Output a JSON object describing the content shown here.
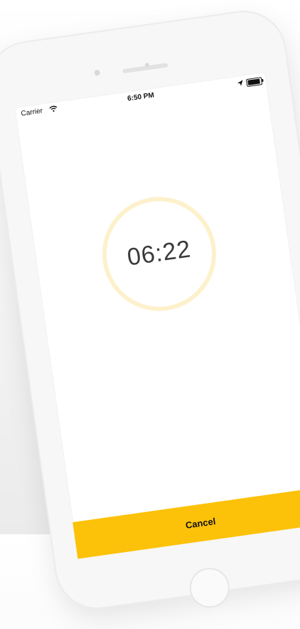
{
  "status_bar": {
    "carrier": "Carrier",
    "time": "6:50 PM",
    "icons": [
      "wifi-icon",
      "location-arrow-icon",
      "battery-icon"
    ]
  },
  "timer": {
    "value": "06:22",
    "ring_color": "#fdf1cc"
  },
  "actions": {
    "cancel_label": "Cancel",
    "accent_color": "#fcc20a"
  }
}
